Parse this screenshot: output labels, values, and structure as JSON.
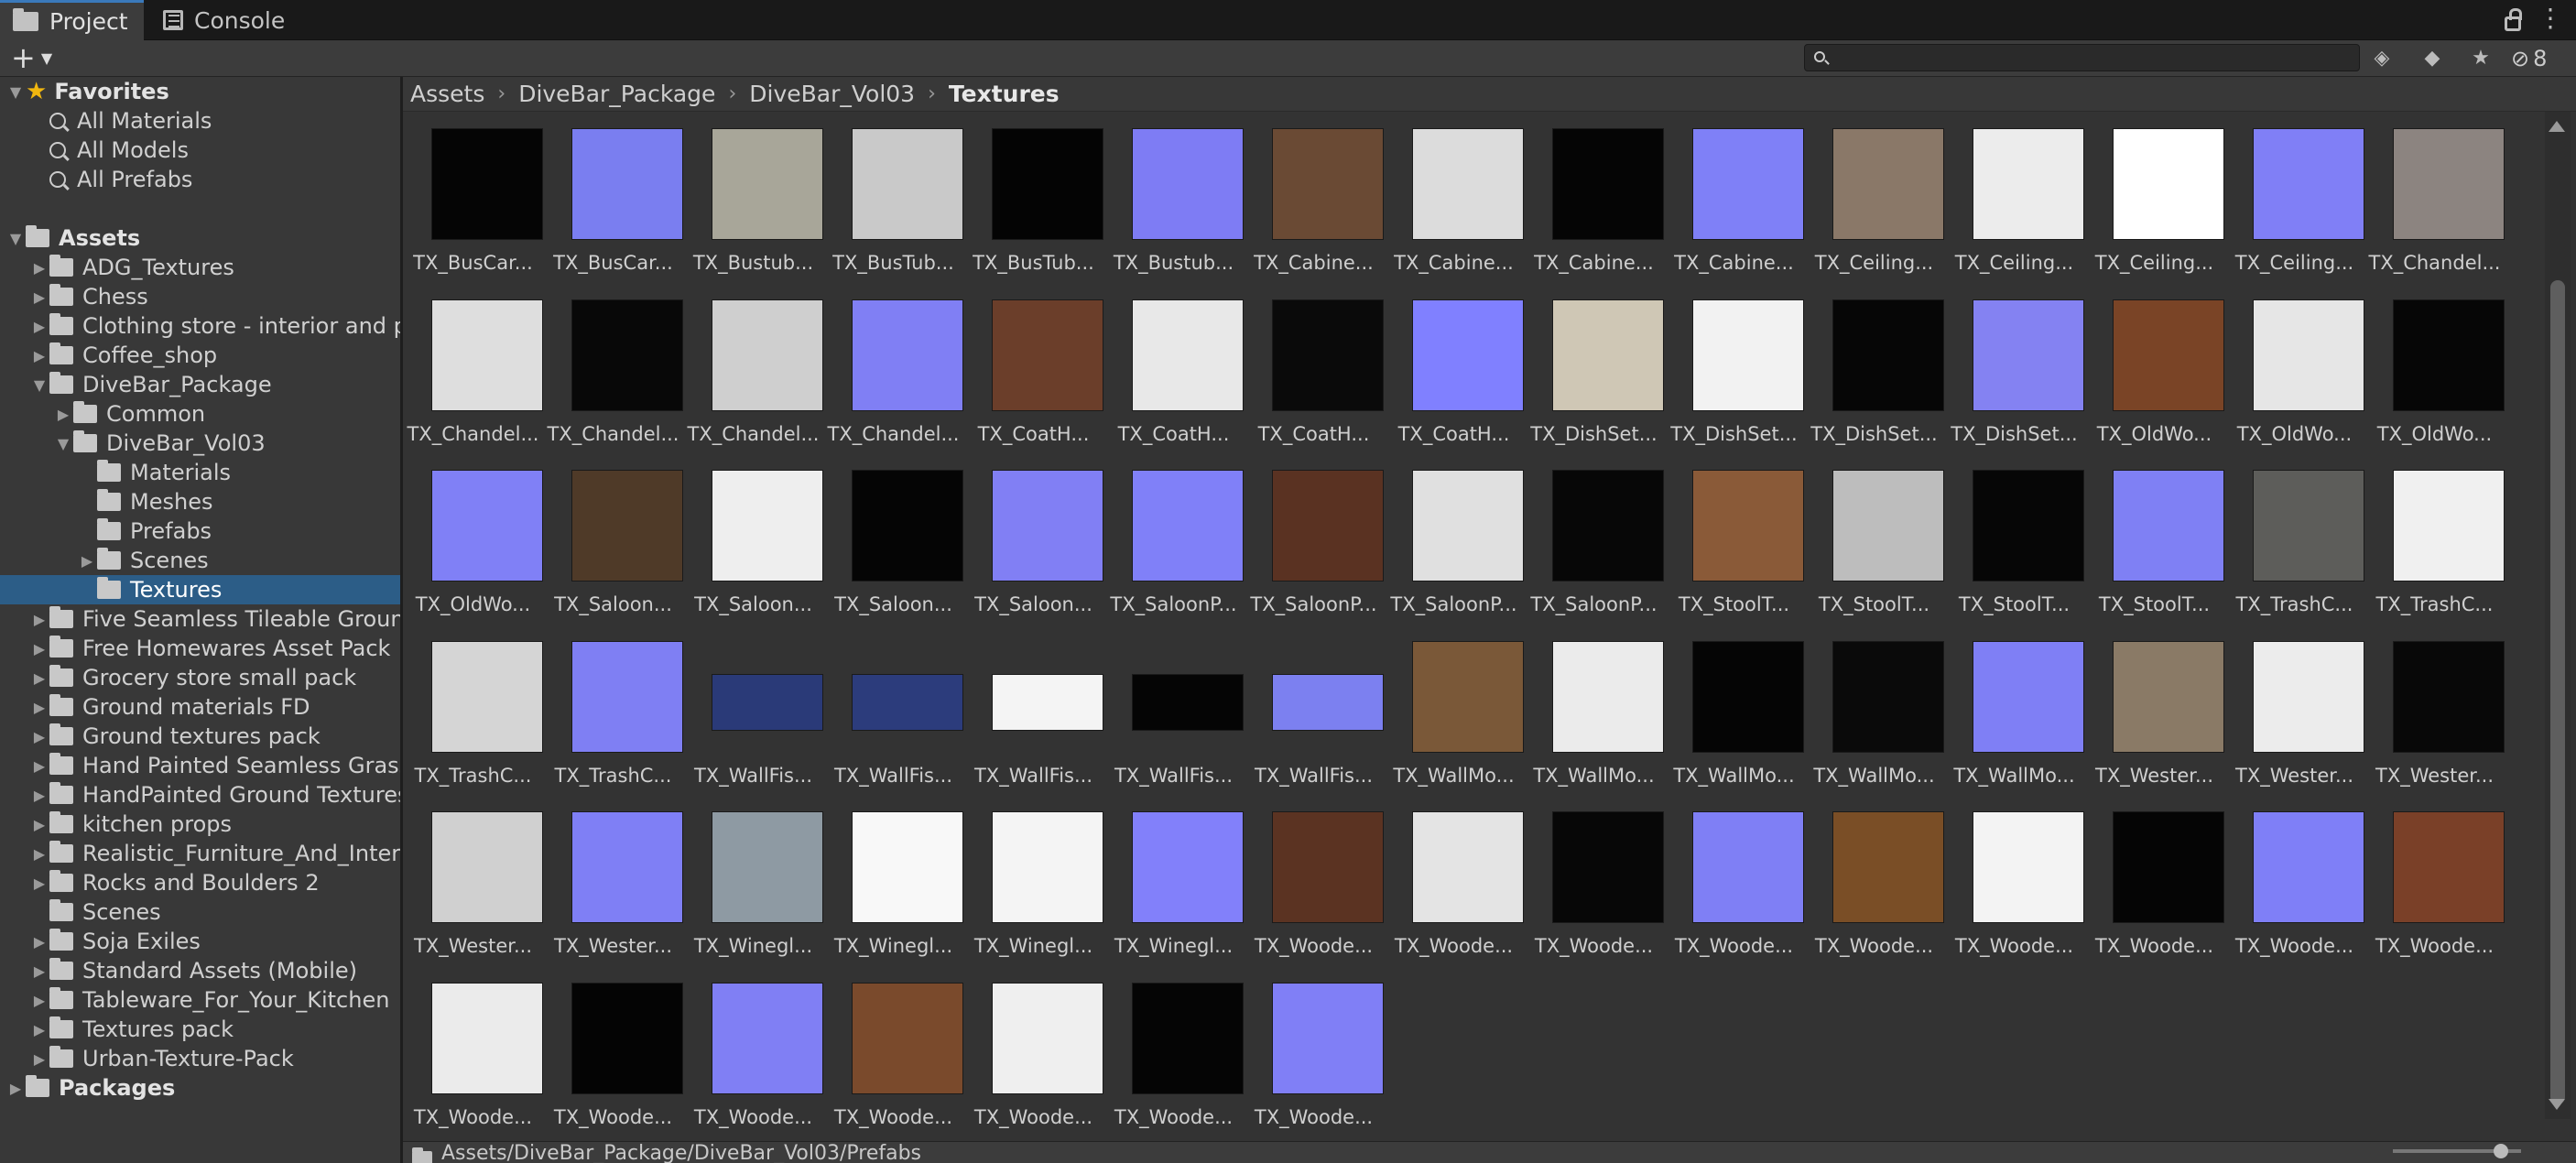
{
  "tabs": [
    {
      "label": "Project",
      "icon": "folder-icon",
      "active": true
    },
    {
      "label": "Console",
      "icon": "console-icon",
      "active": false
    }
  ],
  "toolbar": {
    "create_label": "+",
    "search_placeholder": "",
    "hidden_packages_count": "8"
  },
  "sidebar": {
    "items": [
      {
        "label": "Favorites",
        "indent": 0,
        "arrow": "▼",
        "icon": "star-icon",
        "bold": true
      },
      {
        "label": "All Materials",
        "indent": 1,
        "arrow": "",
        "icon": "search-icon",
        "bold": false
      },
      {
        "label": "All Models",
        "indent": 1,
        "arrow": "",
        "icon": "search-icon",
        "bold": false
      },
      {
        "label": "All Prefabs",
        "indent": 1,
        "arrow": "",
        "icon": "search-icon",
        "bold": false
      },
      {
        "label": "",
        "indent": 0,
        "arrow": "",
        "icon": "",
        "bold": false
      },
      {
        "label": "Assets",
        "indent": 0,
        "arrow": "▼",
        "icon": "folder-icon",
        "bold": true
      },
      {
        "label": "ADG_Textures",
        "indent": 1,
        "arrow": "▶",
        "icon": "folder-icon",
        "bold": false
      },
      {
        "label": "Chess",
        "indent": 1,
        "arrow": "▶",
        "icon": "folder-icon",
        "bold": false
      },
      {
        "label": "Clothing store - interior and pro",
        "indent": 1,
        "arrow": "▶",
        "icon": "folder-icon",
        "bold": false
      },
      {
        "label": "Coffee_shop",
        "indent": 1,
        "arrow": "▶",
        "icon": "folder-icon",
        "bold": false
      },
      {
        "label": "DiveBar_Package",
        "indent": 1,
        "arrow": "▼",
        "icon": "folder-icon",
        "bold": false
      },
      {
        "label": "Common",
        "indent": 2,
        "arrow": "▶",
        "icon": "folder-icon",
        "bold": false
      },
      {
        "label": "DiveBar_Vol03",
        "indent": 2,
        "arrow": "▼",
        "icon": "folder-icon",
        "bold": false
      },
      {
        "label": "Materials",
        "indent": 3,
        "arrow": "",
        "icon": "folder-icon",
        "bold": false
      },
      {
        "label": "Meshes",
        "indent": 3,
        "arrow": "",
        "icon": "folder-icon",
        "bold": false
      },
      {
        "label": "Prefabs",
        "indent": 3,
        "arrow": "",
        "icon": "folder-icon",
        "bold": false
      },
      {
        "label": "Scenes",
        "indent": 3,
        "arrow": "▶",
        "icon": "folder-icon",
        "bold": false
      },
      {
        "label": "Textures",
        "indent": 3,
        "arrow": "",
        "icon": "folder-icon",
        "bold": false,
        "selected": true
      },
      {
        "label": "Five Seamless Tileable Ground",
        "indent": 1,
        "arrow": "▶",
        "icon": "folder-icon",
        "bold": false
      },
      {
        "label": "Free Homewares Asset Pack",
        "indent": 1,
        "arrow": "▶",
        "icon": "folder-icon",
        "bold": false
      },
      {
        "label": "Grocery store small pack",
        "indent": 1,
        "arrow": "▶",
        "icon": "folder-icon",
        "bold": false
      },
      {
        "label": "Ground materials FD",
        "indent": 1,
        "arrow": "▶",
        "icon": "folder-icon",
        "bold": false
      },
      {
        "label": "Ground textures pack",
        "indent": 1,
        "arrow": "▶",
        "icon": "folder-icon",
        "bold": false
      },
      {
        "label": "Hand Painted Seamless Grass",
        "indent": 1,
        "arrow": "▶",
        "icon": "folder-icon",
        "bold": false
      },
      {
        "label": "HandPainted Ground Textures",
        "indent": 1,
        "arrow": "▶",
        "icon": "folder-icon",
        "bold": false
      },
      {
        "label": "kitchen props",
        "indent": 1,
        "arrow": "▶",
        "icon": "folder-icon",
        "bold": false
      },
      {
        "label": "Realistic_Furniture_And_Interio",
        "indent": 1,
        "arrow": "▶",
        "icon": "folder-icon",
        "bold": false
      },
      {
        "label": "Rocks and Boulders 2",
        "indent": 1,
        "arrow": "▶",
        "icon": "folder-icon",
        "bold": false
      },
      {
        "label": "Scenes",
        "indent": 1,
        "arrow": "",
        "icon": "folder-icon",
        "bold": false
      },
      {
        "label": "Soja Exiles",
        "indent": 1,
        "arrow": "▶",
        "icon": "folder-icon",
        "bold": false
      },
      {
        "label": "Standard Assets (Mobile)",
        "indent": 1,
        "arrow": "▶",
        "icon": "folder-icon",
        "bold": false
      },
      {
        "label": "Tableware_For_Your_Kitchen",
        "indent": 1,
        "arrow": "▶",
        "icon": "folder-icon",
        "bold": false
      },
      {
        "label": "Textures pack",
        "indent": 1,
        "arrow": "▶",
        "icon": "folder-icon",
        "bold": false
      },
      {
        "label": "Urban-Texture-Pack",
        "indent": 1,
        "arrow": "▶",
        "icon": "folder-icon",
        "bold": false
      },
      {
        "label": "Packages",
        "indent": 0,
        "arrow": "▶",
        "icon": "folder-icon",
        "bold": true
      }
    ]
  },
  "breadcrumb": [
    "Assets",
    "DiveBar_Package",
    "DiveBar_Vol03",
    "Textures"
  ],
  "assets": [
    {
      "label": "TX_BusCar...",
      "swatch": "#050505"
    },
    {
      "label": "TX_BusCar...",
      "swatch": "#7a7ef0"
    },
    {
      "label": "TX_Bustub...",
      "swatch": "#a8a699"
    },
    {
      "label": "TX_BusTub...",
      "swatch": "#c9c9c9"
    },
    {
      "label": "TX_BusTub...",
      "swatch": "#040404"
    },
    {
      "label": "TX_Bustub...",
      "swatch": "#7e7cf4"
    },
    {
      "label": "TX_Cabine...",
      "swatch": "#6a4a34"
    },
    {
      "label": "TX_Cabine...",
      "swatch": "#dcdcdc"
    },
    {
      "label": "TX_Cabine...",
      "swatch": "#050505"
    },
    {
      "label": "TX_Cabine...",
      "swatch": "#7f80f7"
    },
    {
      "label": "TX_Ceiling...",
      "swatch": "#8a7868"
    },
    {
      "label": "TX_Ceiling...",
      "swatch": "#ececec"
    },
    {
      "label": "TX_Ceiling...",
      "swatch": "#ffffff"
    },
    {
      "label": "TX_Ceiling...",
      "swatch": "#807ff6"
    },
    {
      "label": "TX_Chandel...",
      "swatch": "#8c8480"
    },
    {
      "label": "TX_Chandel...",
      "swatch": "#dedede"
    },
    {
      "label": "TX_Chandel...",
      "swatch": "#080808"
    },
    {
      "label": "TX_Chandel...",
      "swatch": "#cfcfcf"
    },
    {
      "label": "TX_Chandel...",
      "swatch": "#807ff4"
    },
    {
      "label": "TX_CoatH...",
      "swatch": "#6b3e2a"
    },
    {
      "label": "TX_CoatH...",
      "swatch": "#e8e8e8"
    },
    {
      "label": "TX_CoatH...",
      "swatch": "#0a0a0a"
    },
    {
      "label": "TX_CoatH...",
      "swatch": "#8080ff"
    },
    {
      "label": "TX_DishSet...",
      "swatch": "#cfc7b5"
    },
    {
      "label": "TX_DishSet...",
      "swatch": "#f2f2f2"
    },
    {
      "label": "TX_DishSet...",
      "swatch": "#060606"
    },
    {
      "label": "TX_DishSet...",
      "swatch": "#8482f2"
    },
    {
      "label": "TX_OldWo...",
      "swatch": "#7a4426"
    },
    {
      "label": "TX_OldWo...",
      "swatch": "#e6e6e6"
    },
    {
      "label": "TX_OldWo...",
      "swatch": "#060606"
    },
    {
      "label": "TX_OldWo...",
      "swatch": "#8080f6"
    },
    {
      "label": "TX_Saloon...",
      "swatch": "#4f3a28"
    },
    {
      "label": "TX_Saloon...",
      "swatch": "#eeeeee"
    },
    {
      "label": "TX_Saloon...",
      "swatch": "#050505"
    },
    {
      "label": "TX_Saloon...",
      "swatch": "#817ff4"
    },
    {
      "label": "TX_SaloonP...",
      "swatch": "#8080f8"
    },
    {
      "label": "TX_SaloonP...",
      "swatch": "#5a3222"
    },
    {
      "label": "TX_SaloonP...",
      "swatch": "#e0e0e0"
    },
    {
      "label": "TX_SaloonP...",
      "swatch": "#070707"
    },
    {
      "label": "TX_StoolT...",
      "swatch": "#8a5a38"
    },
    {
      "label": "TX_StoolT...",
      "swatch": "#bdbdbd"
    },
    {
      "label": "TX_StoolT...",
      "swatch": "#060606"
    },
    {
      "label": "TX_StoolT...",
      "swatch": "#7f80f4"
    },
    {
      "label": "TX_TrashC...",
      "swatch": "#5d5d5a"
    },
    {
      "label": "TX_TrashC...",
      "swatch": "#f0f0f0"
    },
    {
      "label": "TX_TrashC...",
      "swatch": "#d5d5d5"
    },
    {
      "label": "TX_TrashC...",
      "swatch": "#7f7ff3"
    },
    {
      "label": "TX_WallFis...",
      "swatch": "#2a3a78",
      "wide": true
    },
    {
      "label": "TX_WallFis...",
      "swatch": "#2c3c7c",
      "wide": true
    },
    {
      "label": "TX_WallFis...",
      "swatch": "#f4f4f4",
      "wide": true
    },
    {
      "label": "TX_WallFis...",
      "swatch": "#050505",
      "wide": true
    },
    {
      "label": "TX_WallFis...",
      "swatch": "#7c80f0",
      "wide": true
    },
    {
      "label": "TX_WallMo...",
      "swatch": "#7a5838"
    },
    {
      "label": "TX_WallMo...",
      "swatch": "#ebebeb"
    },
    {
      "label": "TX_WallMo...",
      "swatch": "#050505"
    },
    {
      "label": "TX_WallMo...",
      "swatch": "#0a0a0a"
    },
    {
      "label": "TX_WallMo...",
      "swatch": "#7f7ff5"
    },
    {
      "label": "TX_Wester...",
      "swatch": "#8a7a66"
    },
    {
      "label": "TX_Wester...",
      "swatch": "#ececec"
    },
    {
      "label": "TX_Wester...",
      "swatch": "#080808"
    },
    {
      "label": "TX_Wester...",
      "swatch": "#d0d0d0"
    },
    {
      "label": "TX_Wester...",
      "swatch": "#7f7ff5"
    },
    {
      "label": "TX_Winegl...",
      "swatch": "#8e9aa3"
    },
    {
      "label": "TX_Winegl...",
      "swatch": "#f8f8f8"
    },
    {
      "label": "TX_Winegl...",
      "swatch": "#f4f4f4"
    },
    {
      "label": "TX_Winegl...",
      "swatch": "#8280fa"
    },
    {
      "label": "TX_Woode...",
      "swatch": "#5b3322"
    },
    {
      "label": "TX_Woode...",
      "swatch": "#e4e4e4"
    },
    {
      "label": "TX_Woode...",
      "swatch": "#070707"
    },
    {
      "label": "TX_Woode...",
      "swatch": "#7f7ff5"
    },
    {
      "label": "TX_Woode...",
      "swatch": "#7a4e26"
    },
    {
      "label": "TX_Woode...",
      "swatch": "#f3f3f3"
    },
    {
      "label": "TX_Woode...",
      "swatch": "#050505"
    },
    {
      "label": "TX_Woode...",
      "swatch": "#7f7ff7"
    },
    {
      "label": "TX_Woode...",
      "swatch": "#7a4028"
    },
    {
      "label": "TX_Woode...",
      "swatch": "#ebebeb"
    },
    {
      "label": "TX_Woode...",
      "swatch": "#040404"
    },
    {
      "label": "TX_Woode...",
      "swatch": "#807ff4"
    },
    {
      "label": "TX_Woode...",
      "swatch": "#7a4a2c"
    },
    {
      "label": "TX_Woode...",
      "swatch": "#efefef"
    },
    {
      "label": "TX_Woode...",
      "swatch": "#050505"
    },
    {
      "label": "TX_Woode...",
      "swatch": "#807ff6"
    }
  ],
  "status": {
    "path": "Assets/DiveBar_Package/DiveBar_Vol03/Prefabs"
  },
  "colors": {
    "selection": "#2c5d87",
    "favorites_star": "#f1b70f",
    "tab_accent": "#3a79bb"
  }
}
